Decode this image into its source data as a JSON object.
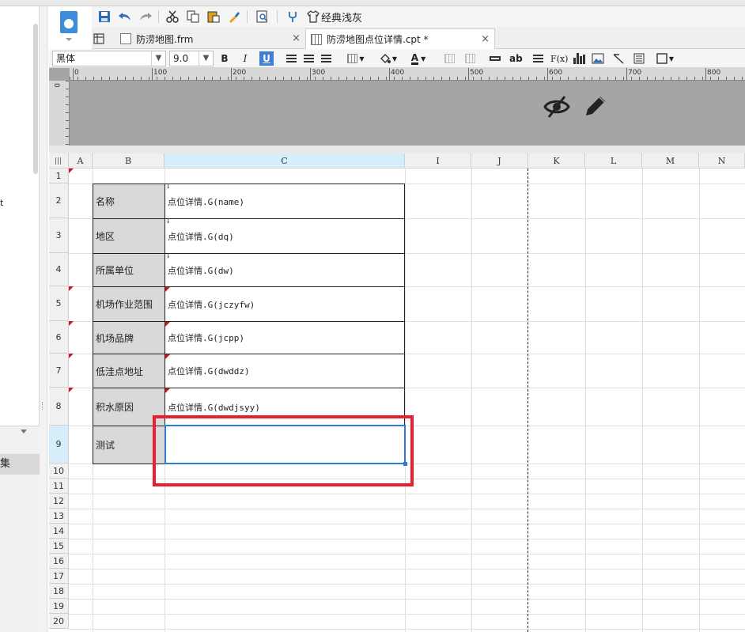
{
  "toolbar": {
    "style_label": "经典浅灰"
  },
  "tabs": [
    {
      "label": "防涝地图.frm",
      "close": "×"
    },
    {
      "label": "防涝地图点位详情.cpt *",
      "close": "×"
    }
  ],
  "format": {
    "font_name": "黑体",
    "font_size": "9.0",
    "bold": "B",
    "italic": "I",
    "underline": "U",
    "font_color": "A",
    "text_label": "ab",
    "formula_label": "F(x)"
  },
  "left_panel": {
    "t_label": "t",
    "dataset_label": "集"
  },
  "ruler": {
    "marks": [
      "0",
      "100",
      "200",
      "300",
      "400",
      "500",
      "600",
      "700",
      "800"
    ],
    "v_mark": "0"
  },
  "columns": [
    "A",
    "B",
    "C",
    "I",
    "J",
    "K",
    "L",
    "M",
    "N"
  ],
  "rows": [
    "1",
    "2",
    "3",
    "4",
    "5",
    "6",
    "7",
    "8",
    "9",
    "10",
    "11",
    "12",
    "13",
    "14",
    "15",
    "16",
    "17",
    "18",
    "19",
    "20"
  ],
  "table": [
    {
      "label": "名称",
      "value": "点位详情.G(name)"
    },
    {
      "label": "地区",
      "value": "点位详情.G(dq)"
    },
    {
      "label": "所属单位",
      "value": "点位详情.G(dw)"
    },
    {
      "label": "机场作业范围",
      "value": "点位详情.G(jczyfw)"
    },
    {
      "label": "机场品牌",
      "value": "点位详情.G(jcpp)"
    },
    {
      "label": "低洼点地址",
      "value": "点位详情.G(dwddz)"
    },
    {
      "label": "积水原因",
      "value": "点位详情.G(dwdjsyy)"
    },
    {
      "label": "测试",
      "value": ""
    }
  ]
}
